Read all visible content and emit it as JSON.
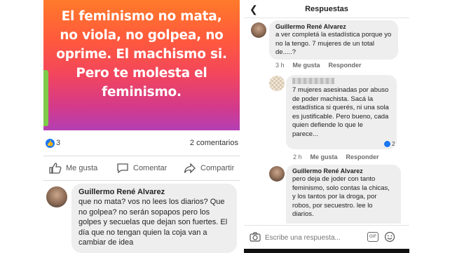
{
  "left_post": {
    "quote": [
      "El feminismo no mata,",
      "no viola, no golpea, no",
      "oprime. El machismo si.",
      "Pero te molesta el",
      "feminismo."
    ],
    "like_count": "3",
    "comments_count": "2 comentarios",
    "actions": {
      "like": "Me gusta",
      "comment": "Comentar",
      "share": "Compartir"
    },
    "comment": {
      "author": "Guillermo René Alvarez",
      "text": "que no mata? vos no lees los diarios? Que no golpea? no serán sopapos pero los golpes y secuelas que dejan son fuertes. El día que no tengan quien la coja van a cambiar de idea"
    }
  },
  "replies_panel": {
    "title": "Respuestas",
    "comments": [
      {
        "author": "Guillermo René Alvarez",
        "text": "a ver completá la estadística porque yo no la tengo. 7 mujeres de un total de.....?",
        "time": "3 h",
        "like": "Me gusta",
        "reply": "Responder"
      },
      {
        "author": "",
        "text": "7 mujeres asesinadas por abuso de poder machista. Sacá la estadística si querés, ni una sola es justificable. Pero bueno, cada quien defiende lo que le parece...",
        "time": "2 h",
        "like": "Me gusta",
        "reply": "Responder",
        "reactions": "2"
      },
      {
        "author": "Guillermo René Alvarez",
        "text": "pero deja de joder con tanto feminismo, solo contas la chicas, y los tantos por la droga, por robos, por secuestro. lee lo diarios."
      }
    ],
    "composer": {
      "placeholder": "Escribe una respuesta...",
      "gif": "GIF"
    }
  }
}
